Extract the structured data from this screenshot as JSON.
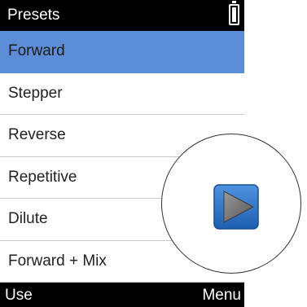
{
  "header": {
    "title": "Presets"
  },
  "presets": [
    {
      "label": "Forward",
      "selected": true
    },
    {
      "label": "Stepper",
      "selected": false
    },
    {
      "label": "Reverse",
      "selected": false
    },
    {
      "label": "Repetitive",
      "selected": false
    },
    {
      "label": "Dilute",
      "selected": false
    },
    {
      "label": "Forward + Mix",
      "selected": false
    }
  ],
  "softkeys": {
    "left": "Use",
    "right": "Menu"
  },
  "colors": {
    "selection": "#5b8ed6",
    "bar_background": "#000000",
    "play_button": "#2f74c8"
  },
  "icons": {
    "battery": "battery-icon",
    "play": "play-icon"
  }
}
